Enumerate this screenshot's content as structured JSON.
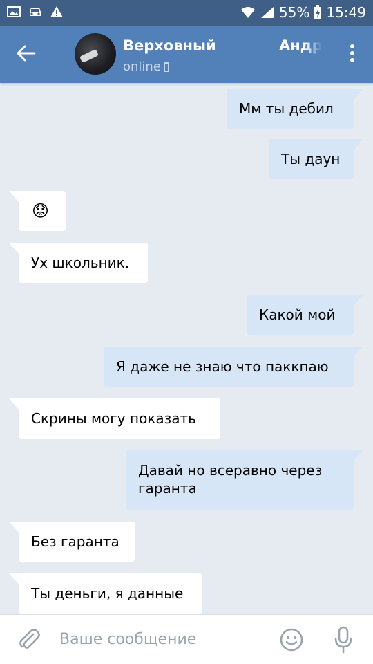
{
  "status_bar": {
    "battery": "55%",
    "time": "15:49",
    "icons": [
      "image-icon",
      "car-icon",
      "warning-icon",
      "wifi-icon",
      "signal-icon",
      "battery-charging-icon"
    ]
  },
  "header": {
    "name_first": "Верховный",
    "name_second": "Андр",
    "status": "online",
    "status_icon": "phone-icon",
    "back_icon": "arrow-left-icon",
    "menu_icon": "more-vertical-icon"
  },
  "colors": {
    "header": "#5181b8",
    "status_bar": "#3f5f87",
    "background": "#e6ebf1",
    "outgoing": "#d7e6f7",
    "incoming": "#ffffff"
  },
  "messages": [
    {
      "dir": "out",
      "text": "Мм ты дебил"
    },
    {
      "dir": "out",
      "text": "Ты даун"
    },
    {
      "dir": "in",
      "text": "😟"
    },
    {
      "dir": "in",
      "text": "Ух школьник."
    },
    {
      "dir": "out",
      "text": "Какой мой"
    },
    {
      "dir": "out",
      "text": "Я даже не знаю что паккпаю"
    },
    {
      "dir": "in",
      "text": "Скрины могу показать"
    },
    {
      "dir": "out",
      "text": "Давай но всеравно через гаранта"
    },
    {
      "dir": "in",
      "text": "Без гаранта"
    },
    {
      "dir": "in",
      "text": "Ты деньги, я данные"
    }
  ],
  "composer": {
    "placeholder": "Ваше сообщение",
    "attach_icon": "paperclip-icon",
    "emoji_icon": "smile-icon",
    "mic_icon": "microphone-icon"
  }
}
